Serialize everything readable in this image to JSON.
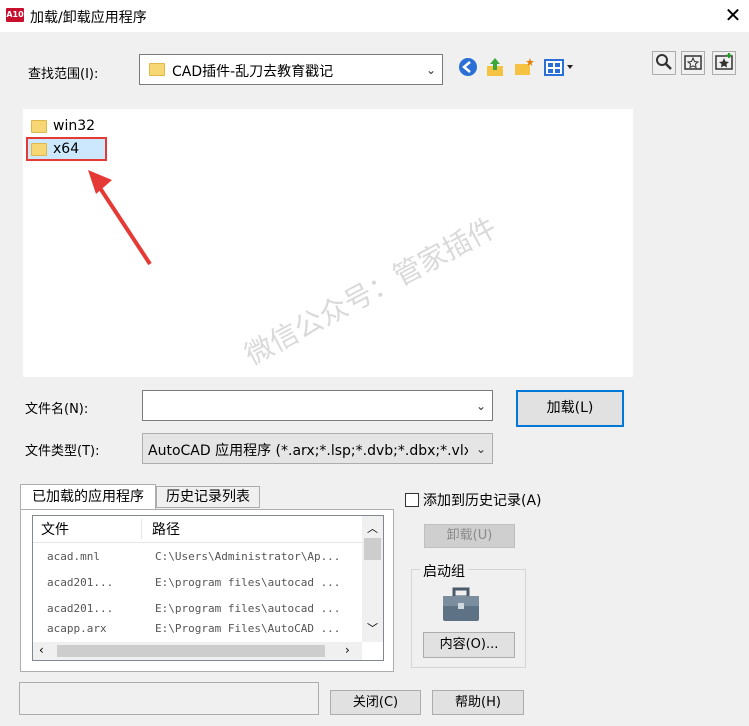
{
  "window": {
    "title": "加载/卸载应用程序",
    "app_icon_text": "A10"
  },
  "lookin": {
    "label": "查找范围(I):",
    "value": "CAD插件-乱刀去教育戳记"
  },
  "toolbar": {
    "icons": [
      "back-icon",
      "up-folder-icon",
      "new-folder-icon",
      "views-icon"
    ],
    "right_icons": [
      "find-icon",
      "favorites-icon",
      "add-favorite-icon"
    ]
  },
  "files": [
    {
      "name": "win32",
      "selected": false
    },
    {
      "name": "x64",
      "selected": true
    }
  ],
  "filename": {
    "label": "文件名(N):",
    "value": ""
  },
  "filetype": {
    "label": "文件类型(T):",
    "value": "AutoCAD 应用程序 (*.arx;*.lsp;*.dvb;*.dbx;*.vlx"
  },
  "load_button": "加载(L)",
  "watermark": "微信公众号：管家插件",
  "tabs": [
    {
      "label": "已加载的应用程序",
      "active": true
    },
    {
      "label": "历史记录列表",
      "active": false
    }
  ],
  "loaded_list": {
    "columns": [
      "文件",
      "路径"
    ],
    "rows": [
      {
        "file": "acad.mnl",
        "path": "C:\\Users\\Administrator\\Ap..."
      },
      {
        "file": "acad201...",
        "path": "E:\\program files\\autocad ..."
      },
      {
        "file": "acad201...",
        "path": "E:\\program files\\autocad ..."
      },
      {
        "file": "acapp.arx",
        "path": "E:\\Program Files\\AutoCAD ..."
      }
    ]
  },
  "add_history": {
    "label": "添加到历史记录(A)",
    "checked": false
  },
  "unload_button": "卸载(U)",
  "startup": {
    "title": "启动组",
    "contents_button": "内容(O)..."
  },
  "close_button": "关闭(C)",
  "help_button": "帮助(H)",
  "colors": {
    "accent": "#0078d7",
    "selection_outline": "#e53935",
    "arrow": "#e53935"
  }
}
